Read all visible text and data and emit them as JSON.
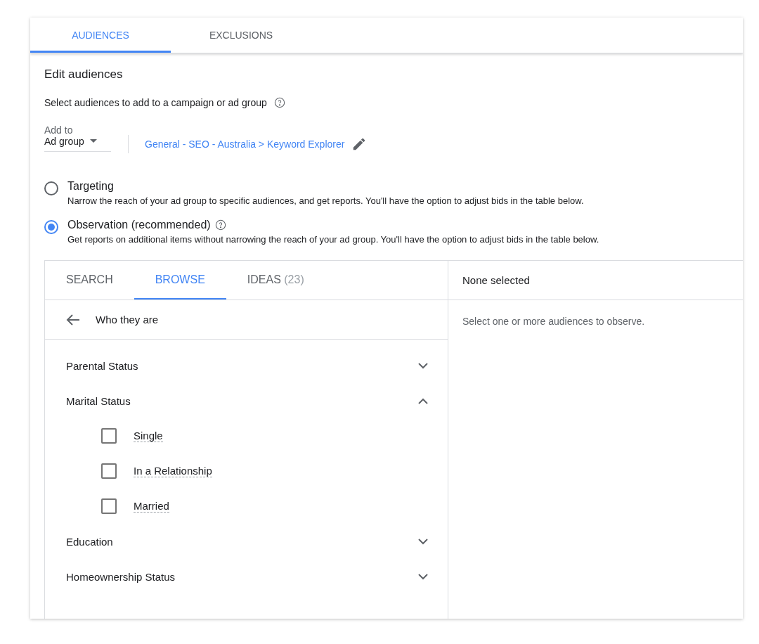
{
  "tabs": [
    {
      "label": "AUDIENCES",
      "selected": true
    },
    {
      "label": "EXCLUSIONS",
      "selected": false
    }
  ],
  "heading": "Edit audiences",
  "intro": "Select audiences to add to a campaign or ad group",
  "add_to": {
    "label": "Add to",
    "value": "Ad group"
  },
  "ad_group_link": "General - SEO - Australia > Keyword Explorer",
  "modes": [
    {
      "title": "Targeting",
      "description": "Narrow the reach of your ad group to specific audiences, and get reports. You'll have the option to adjust bids in the table below.",
      "selected": false,
      "help": false
    },
    {
      "title": "Observation (recommended)",
      "description": "Get reports on additional items without narrowing the reach of your ad group. You'll have the option to adjust bids in the table below.",
      "selected": true,
      "help": true
    }
  ],
  "browser_tabs": [
    {
      "label": "SEARCH",
      "selected": false
    },
    {
      "label": "BROWSE",
      "selected": true
    },
    {
      "label": "IDEAS",
      "count": "(23)",
      "selected": false
    }
  ],
  "back_title": "Who they are",
  "categories": [
    {
      "label": "Parental Status",
      "expanded": false
    },
    {
      "label": "Marital Status",
      "expanded": true,
      "children": [
        {
          "label": "Single",
          "checked": false
        },
        {
          "label": "In a Relationship",
          "checked": false
        },
        {
          "label": "Married",
          "checked": false
        }
      ]
    },
    {
      "label": "Education",
      "expanded": false
    },
    {
      "label": "Homeownership Status",
      "expanded": false
    }
  ],
  "selection": {
    "title": "None selected",
    "empty_message": "Select one or more audiences to observe."
  }
}
